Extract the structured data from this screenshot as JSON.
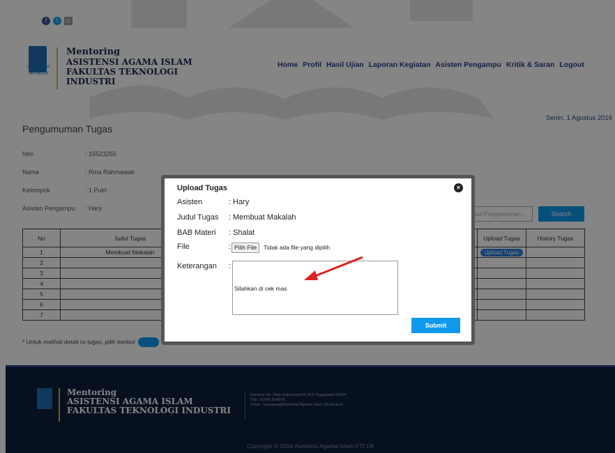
{
  "header": {
    "brand_line1": "Mentoring",
    "brand_line2": "ASISTENSI AGAMA ISLAM",
    "brand_line3": "FAKULTAS TEKNOLOGI",
    "brand_line4": "INDUSTRI",
    "logo_text": "UNIVERSITAS ISLAM INDONESIA",
    "nav": [
      "Home",
      "Profil",
      "Hasil Ujian",
      "Laporan Kegiatan",
      "Asisten Pengampu",
      "Kritik & Saran",
      "Logout"
    ],
    "date": "Senin, 1 Agustus 2016"
  },
  "page": {
    "title": "Pengumuman Tugas",
    "info": [
      {
        "label": "Nim",
        "value": ": 15523255"
      },
      {
        "label": "Nama",
        "value": ": Rina Rahmawati"
      },
      {
        "label": "Kelompok",
        "value": ": 1 Putri"
      },
      {
        "label": "Asisten Pengampu",
        "value": ": Hary"
      }
    ],
    "search_placeholder": "Judul Pengumuman...",
    "search_label": "Search",
    "table_headers": [
      "No",
      "Judul Tugas",
      "Upload Tugas",
      "History Tugas"
    ],
    "rows": [
      {
        "no": "1",
        "judul": "Membuat Makalah",
        "upload": "Upload Tugas"
      },
      {
        "no": "2",
        "judul": "",
        "upload": ""
      },
      {
        "no": "3",
        "judul": "",
        "upload": ""
      },
      {
        "no": "4",
        "judul": "",
        "upload": ""
      },
      {
        "no": "5",
        "judul": "",
        "upload": ""
      },
      {
        "no": "6",
        "judul": "",
        "upload": ""
      },
      {
        "no": "7",
        "judul": "",
        "upload": ""
      }
    ],
    "note": "* Untuk melihat detail isi tugas, pilih tombol"
  },
  "modal": {
    "title": "Upload Tugas",
    "fields": [
      {
        "label": "Asisten",
        "value": "Hary"
      },
      {
        "label": "Judul Tugas",
        "value": "Membuat Makalah"
      },
      {
        "label": "BAB Materi",
        "value": "Shalat"
      }
    ],
    "file_label": "File",
    "file_button": "Pilih File",
    "file_status": "Tidak ada file yang dipilih",
    "keterangan_label": "Keterangan",
    "keterangan_value": "Silahkan di cek mas",
    "submit_label": "Submit"
  },
  "footer": {
    "brand_line1": "Mentoring",
    "brand_line2": "ASISTENSI AGAMA ISLAM",
    "brand_line3": "FAKULTAS TEKNOLOGI INDUSTRI",
    "address_line1": "Kampus UII, Jalan Kaliurang Km 14,5 Yogyakarta 55584",
    "address_line2": "Telp. (0284) 554878",
    "address_line3": "Email : humasaai@Asistensi Agama Islam UII.ud.ac.id",
    "copyright": "Copyright © 2016 Asistensi Agama Islam FTI UII"
  },
  "colors": {
    "accent": "#1199ee",
    "navy": "#2a3f87",
    "footer_bg": "#0d1f3d",
    "gold": "#d8b73a",
    "arrow": "#e02020"
  }
}
